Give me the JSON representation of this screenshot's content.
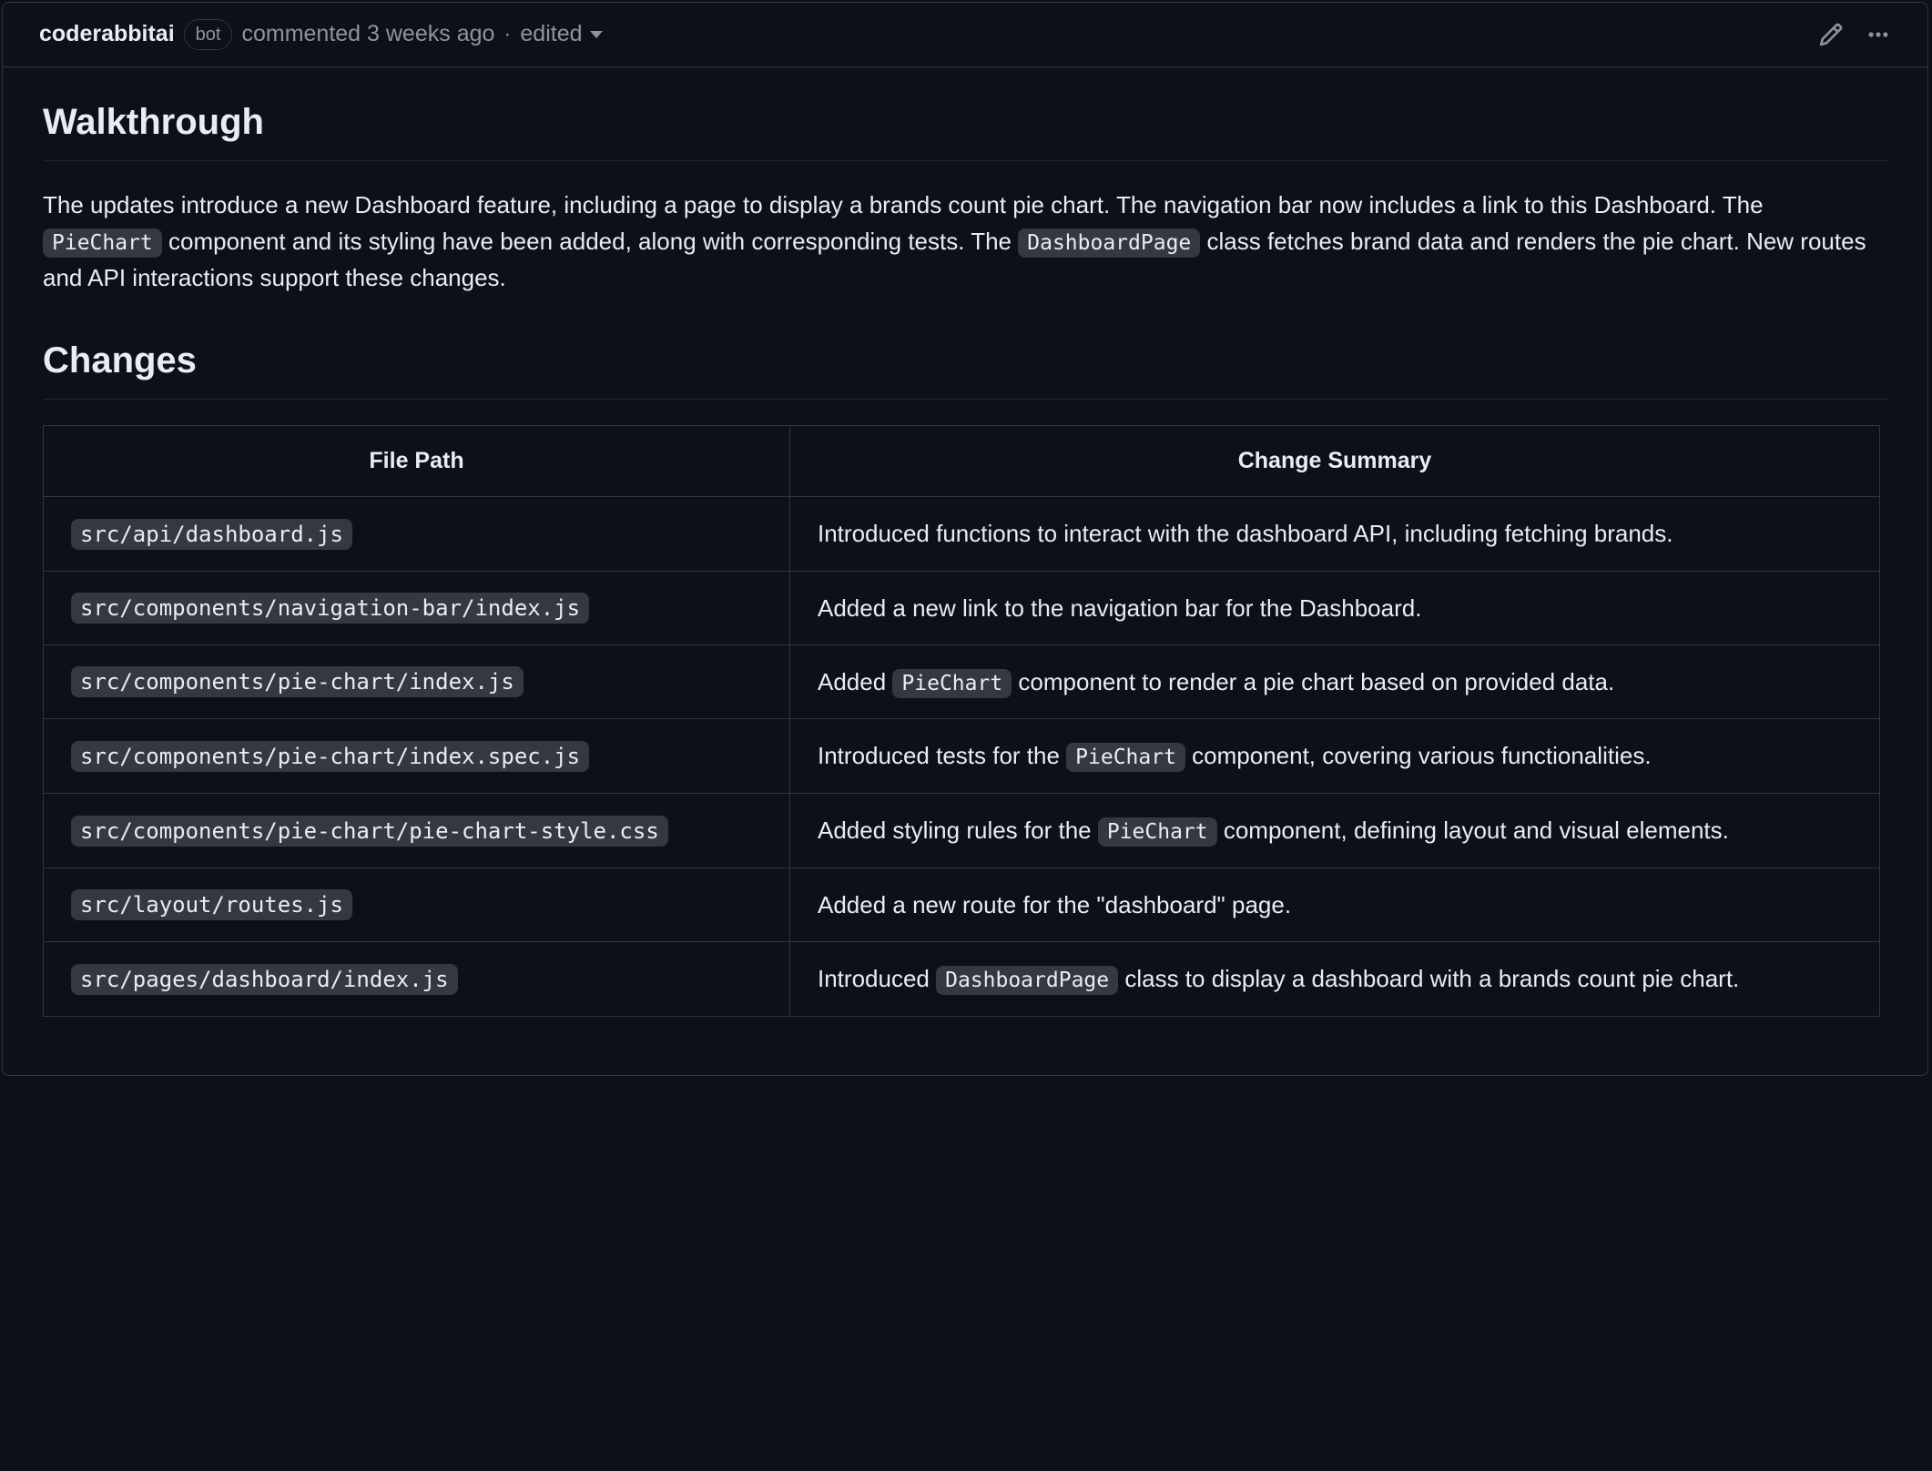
{
  "header": {
    "author": "coderabbitai",
    "bot_label": "bot",
    "timestamp_prefix": "commented ",
    "timestamp": "3 weeks ago",
    "edited_label": "edited"
  },
  "sections": {
    "walkthrough_title": "Walkthrough",
    "changes_title": "Changes"
  },
  "walkthrough": {
    "t1": "The updates introduce a new Dashboard feature, including a page to display a brands count pie chart. The navigation bar now includes a link to this Dashboard. The ",
    "c1": "PieChart",
    "t2": " component and its styling have been added, along with corresponding tests. The ",
    "c2": "DashboardPage",
    "t3": " class fetches brand data and renders the pie chart. New routes and API interactions support these changes."
  },
  "table": {
    "col_file": "File Path",
    "col_summary": "Change Summary",
    "rows": [
      {
        "file": "src/api/dashboard.js",
        "summary": [
          {
            "type": "text",
            "v": "Introduced functions to interact with the dashboard API, including fetching brands."
          }
        ]
      },
      {
        "file": "src/components/navigation-bar/index.js",
        "summary": [
          {
            "type": "text",
            "v": "Added a new link to the navigation bar for the Dashboard."
          }
        ]
      },
      {
        "file": "src/components/pie-chart/index.js",
        "summary": [
          {
            "type": "text",
            "v": "Added "
          },
          {
            "type": "code",
            "v": "PieChart"
          },
          {
            "type": "text",
            "v": " component to render a pie chart based on provided data."
          }
        ]
      },
      {
        "file": "src/components/pie-chart/index.spec.js",
        "summary": [
          {
            "type": "text",
            "v": "Introduced tests for the "
          },
          {
            "type": "code",
            "v": "PieChart"
          },
          {
            "type": "text",
            "v": " component, covering various functionalities."
          }
        ]
      },
      {
        "file": "src/components/pie-chart/pie-chart-style.css",
        "summary": [
          {
            "type": "text",
            "v": "Added styling rules for the "
          },
          {
            "type": "code",
            "v": "PieChart"
          },
          {
            "type": "text",
            "v": " component, defining layout and visual elements."
          }
        ]
      },
      {
        "file": "src/layout/routes.js",
        "summary": [
          {
            "type": "text",
            "v": "Added a new route for the \"dashboard\" page."
          }
        ]
      },
      {
        "file": "src/pages/dashboard/index.js",
        "summary": [
          {
            "type": "text",
            "v": "Introduced "
          },
          {
            "type": "code",
            "v": "DashboardPage"
          },
          {
            "type": "text",
            "v": " class to display a dashboard with a brands count pie chart."
          }
        ]
      }
    ]
  }
}
